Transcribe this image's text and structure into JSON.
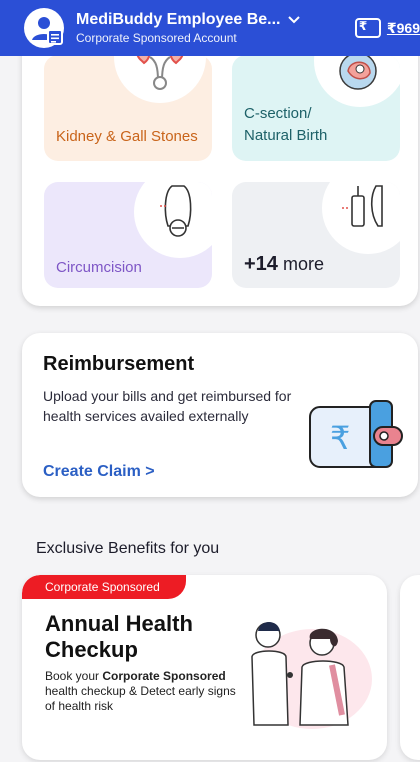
{
  "header": {
    "title": "MediBuddy Employee Be...",
    "subtitle": "Corporate Sponsored Account",
    "wallet_amount": "₹969",
    "wallet_symbol": "₹"
  },
  "procedures": {
    "tiles": [
      {
        "label": "Kidney & Gall Stones",
        "icon": "kidney-icon"
      },
      {
        "label": "C-section/ Natural Birth",
        "icon": "baby-icon"
      },
      {
        "label": "Circumcision",
        "icon": "circumcision-icon"
      },
      {
        "label_count": "+14",
        "label_rest": "more",
        "icon": "syringe-icon"
      }
    ]
  },
  "reimbursement": {
    "title": "Reimbursement",
    "description": "Upload your bills and get reimbursed for health services availed externally",
    "cta": "Create Claim",
    "cta_chevron": ">",
    "wallet_symbol": "₹"
  },
  "benefits": {
    "section_title": "Exclusive Benefits for you",
    "cards": [
      {
        "ribbon": "Corporate Sponsored",
        "title": "Annual Health Checkup",
        "desc_prefix": "Book your ",
        "desc_bold": "Corporate Sponsored",
        "desc_suffix": " health checkup & Detect early signs of health risk"
      }
    ]
  },
  "colors": {
    "header_bg": "#2b4fd6",
    "cta_blue": "#2b5fc4",
    "ribbon_red": "#ed1c24"
  }
}
